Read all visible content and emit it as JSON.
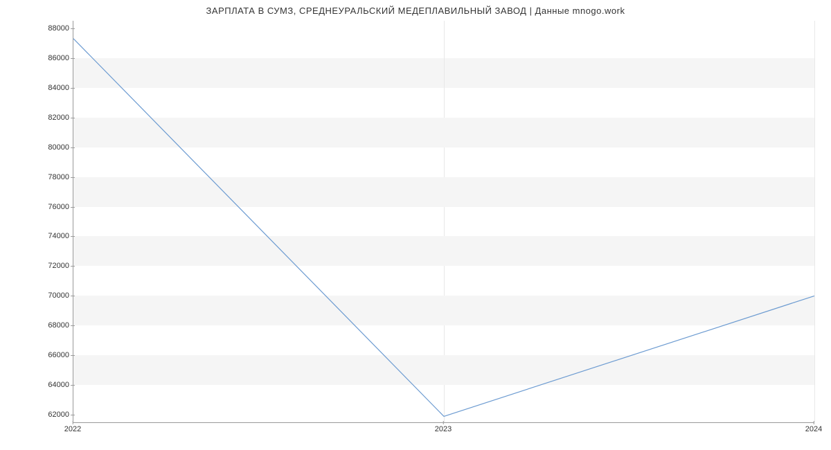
{
  "chart_data": {
    "type": "line",
    "title": "ЗАРПЛАТА В  СУМЗ,  СРЕДНЕУРАЛЬСКИЙ МЕДЕПЛАВИЛЬНЫЙ ЗАВОД | Данные mnogo.work",
    "x": [
      "2022",
      "2023",
      "2024"
    ],
    "values": [
      87300,
      61900,
      70000
    ],
    "xlabel": "",
    "ylabel": "",
    "xticks": [
      "2022",
      "2023",
      "2024"
    ],
    "yticks": [
      62000,
      64000,
      66000,
      68000,
      70000,
      72000,
      74000,
      76000,
      78000,
      80000,
      82000,
      84000,
      86000,
      88000
    ],
    "ylim": [
      61500,
      88500
    ],
    "line_color": "#6c9bd1"
  }
}
